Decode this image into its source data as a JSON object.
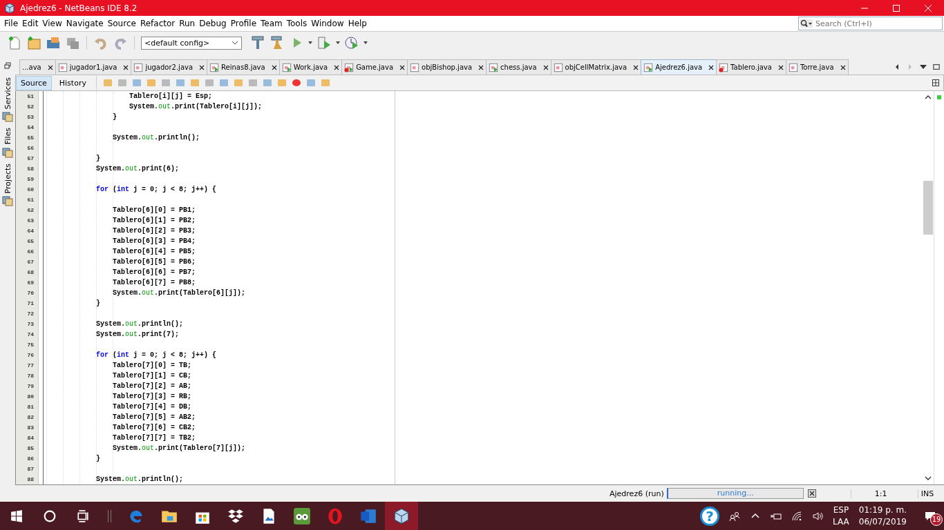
{
  "window": {
    "title": "Ajedrez6 - NetBeans IDE 8.2"
  },
  "menu": [
    "File",
    "Edit",
    "View",
    "Navigate",
    "Source",
    "Refactor",
    "Run",
    "Debug",
    "Profile",
    "Team",
    "Tools",
    "Window",
    "Help"
  ],
  "search": {
    "placeholder": "Search (Ctrl+I)"
  },
  "config": {
    "value": "<default config>"
  },
  "side_panels": [
    "Services",
    "Files",
    "Projects"
  ],
  "tabs": [
    {
      "label": "...ava",
      "kind": "none",
      "error": false,
      "selected": false
    },
    {
      "label": "jugador1.java",
      "kind": "class",
      "error": false,
      "selected": false
    },
    {
      "label": "jugador2.java",
      "kind": "class",
      "error": false,
      "selected": false
    },
    {
      "label": "Reinas8.java",
      "kind": "main",
      "error": false,
      "selected": false
    },
    {
      "label": "Work.java",
      "kind": "main",
      "error": false,
      "selected": false
    },
    {
      "label": "Game.java",
      "kind": "main",
      "error": true,
      "selected": false
    },
    {
      "label": "objBishop.java",
      "kind": "class",
      "error": false,
      "selected": false
    },
    {
      "label": "chess.java",
      "kind": "main",
      "error": false,
      "selected": false
    },
    {
      "label": "objCellMatrix.java",
      "kind": "class",
      "error": false,
      "selected": false
    },
    {
      "label": "Ajedrez6.java",
      "kind": "main",
      "error": false,
      "selected": true
    },
    {
      "label": "Tablero.java",
      "kind": "class",
      "error": true,
      "selected": false
    },
    {
      "label": "Torre.java",
      "kind": "class",
      "error": false,
      "selected": false
    }
  ],
  "editor_tabs": [
    {
      "label": "Source",
      "selected": true
    },
    {
      "label": "History",
      "selected": false
    }
  ],
  "code": [
    {
      "number": "51",
      "parts": [
        {
          "kind": "plain",
          "text": "                    Tablero[i][j] = Esp;"
        }
      ]
    },
    {
      "number": "52",
      "parts": [
        {
          "kind": "plain",
          "text": "                    System."
        },
        {
          "kind": "field",
          "text": "out"
        },
        {
          "kind": "plain",
          "text": ".print(Tablero[i][j]);"
        }
      ]
    },
    {
      "number": "53",
      "parts": [
        {
          "kind": "plain",
          "text": "                }"
        }
      ]
    },
    {
      "number": "54"
    },
    {
      "number": "55",
      "parts": [
        {
          "kind": "plain",
          "text": "                System."
        },
        {
          "kind": "field",
          "text": "out"
        },
        {
          "kind": "plain",
          "text": ".println();"
        }
      ]
    },
    {
      "number": "56"
    },
    {
      "number": "57",
      "parts": [
        {
          "kind": "plain",
          "text": "            }"
        }
      ]
    },
    {
      "number": "58",
      "parts": [
        {
          "kind": "plain",
          "text": "            System."
        },
        {
          "kind": "field",
          "text": "out"
        },
        {
          "kind": "plain",
          "text": ".print(6);"
        }
      ]
    },
    {
      "number": "59"
    },
    {
      "number": "60",
      "parts": [
        {
          "kind": "keyword",
          "text": "            for"
        },
        {
          "kind": "plain",
          "text": " ("
        },
        {
          "kind": "keyword",
          "text": "int"
        },
        {
          "kind": "plain",
          "text": " j = 0; j < 8; j++) {"
        }
      ]
    },
    {
      "number": "61"
    },
    {
      "number": "62",
      "parts": [
        {
          "kind": "plain",
          "text": "                Tablero[6][0] = PB1;"
        }
      ]
    },
    {
      "number": "63",
      "parts": [
        {
          "kind": "plain",
          "text": "                Tablero[6][1] = PB2;"
        }
      ]
    },
    {
      "number": "64",
      "parts": [
        {
          "kind": "plain",
          "text": "                Tablero[6][2] = PB3;"
        }
      ]
    },
    {
      "number": "65",
      "parts": [
        {
          "kind": "plain",
          "text": "                Tablero[6][3] = PB4;"
        }
      ]
    },
    {
      "number": "66",
      "parts": [
        {
          "kind": "plain",
          "text": "                Tablero[6][4] = PB5;"
        }
      ]
    },
    {
      "number": "67",
      "parts": [
        {
          "kind": "plain",
          "text": "                Tablero[6][5] = PB6;"
        }
      ]
    },
    {
      "number": "68",
      "parts": [
        {
          "kind": "plain",
          "text": "                Tablero[6][6] = PB7;"
        }
      ]
    },
    {
      "number": "69",
      "parts": [
        {
          "kind": "plain",
          "text": "                Tablero[6][7] = PB8;"
        }
      ]
    },
    {
      "number": "70",
      "parts": [
        {
          "kind": "plain",
          "text": "                System."
        },
        {
          "kind": "field",
          "text": "out"
        },
        {
          "kind": "plain",
          "text": ".print(Tablero[6][j]);"
        }
      ]
    },
    {
      "number": "71",
      "parts": [
        {
          "kind": "plain",
          "text": "            }"
        }
      ]
    },
    {
      "number": "72"
    },
    {
      "number": "73",
      "parts": [
        {
          "kind": "plain",
          "text": "            System."
        },
        {
          "kind": "field",
          "text": "out"
        },
        {
          "kind": "plain",
          "text": ".println();"
        }
      ]
    },
    {
      "number": "74",
      "parts": [
        {
          "kind": "plain",
          "text": "            System."
        },
        {
          "kind": "field",
          "text": "out"
        },
        {
          "kind": "plain",
          "text": ".print(7);"
        }
      ]
    },
    {
      "number": "75"
    },
    {
      "number": "76",
      "parts": [
        {
          "kind": "keyword",
          "text": "            for"
        },
        {
          "kind": "plain",
          "text": " ("
        },
        {
          "kind": "keyword",
          "text": "int"
        },
        {
          "kind": "plain",
          "text": " j = 0; j < 8; j++) {"
        }
      ]
    },
    {
      "number": "77",
      "parts": [
        {
          "kind": "plain",
          "text": "                Tablero[7][0] = TB;"
        }
      ]
    },
    {
      "number": "78",
      "parts": [
        {
          "kind": "plain",
          "text": "                Tablero[7][1] = CB;"
        }
      ]
    },
    {
      "number": "79",
      "parts": [
        {
          "kind": "plain",
          "text": "                Tablero[7][2] = AB;"
        }
      ]
    },
    {
      "number": "80",
      "parts": [
        {
          "kind": "plain",
          "text": "                Tablero[7][3] = RB;"
        }
      ]
    },
    {
      "number": "81",
      "parts": [
        {
          "kind": "plain",
          "text": "                Tablero[7][4] = DB;"
        }
      ]
    },
    {
      "number": "82",
      "parts": [
        {
          "kind": "plain",
          "text": "                Tablero[7][5] = AB2;"
        }
      ]
    },
    {
      "number": "83",
      "parts": [
        {
          "kind": "plain",
          "text": "                Tablero[7][6] = CB2;"
        }
      ]
    },
    {
      "number": "84",
      "parts": [
        {
          "kind": "plain",
          "text": "                Tablero[7][7] = TB2;"
        }
      ]
    },
    {
      "number": "85",
      "parts": [
        {
          "kind": "plain",
          "text": "                System."
        },
        {
          "kind": "field",
          "text": "out"
        },
        {
          "kind": "plain",
          "text": ".print(Tablero[7][j]);"
        }
      ]
    },
    {
      "number": "86",
      "parts": [
        {
          "kind": "plain",
          "text": "            }"
        }
      ]
    },
    {
      "number": "87"
    },
    {
      "number": "88",
      "parts": [
        {
          "kind": "plain",
          "text": "            System."
        },
        {
          "kind": "field",
          "text": "out"
        },
        {
          "kind": "plain",
          "text": ".println();"
        }
      ]
    }
  ],
  "status_bar": {
    "task": "Ajedrez6 (run)",
    "progress": "running...",
    "position": "1:1",
    "mode": "INS"
  },
  "taskbar": {
    "help": "?",
    "language": "ESP",
    "layout": "LAA",
    "time": "01:19 p. m.",
    "date": "06/07/2019",
    "notifications": "19"
  }
}
